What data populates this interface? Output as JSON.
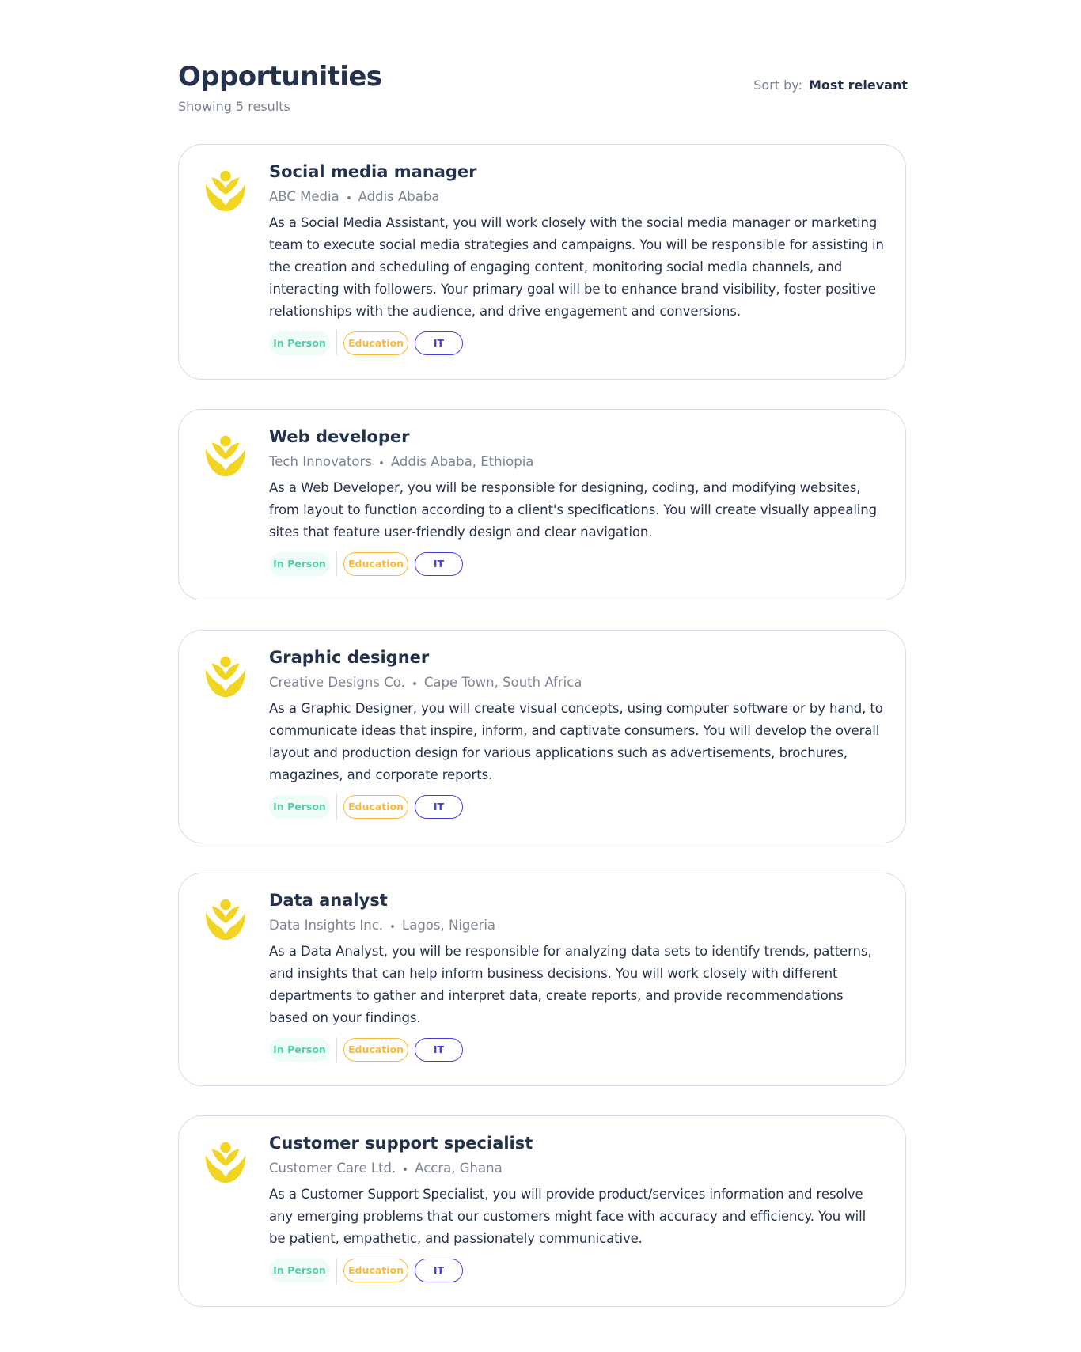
{
  "header": {
    "title": "Opportunities",
    "subtitle": "Showing 5 results",
    "sort_label": "Sort by:",
    "sort_value": "Most relevant"
  },
  "colors": {
    "text_dark": "#25324B",
    "text_muted": "#7C8493",
    "border": "#D6DDEB",
    "in_person_bg": "#EDFCF5",
    "in_person_text": "#56CDAD",
    "education": "#FFB836",
    "it": "#4640DE",
    "logo_yellow": "#F2D422"
  },
  "jobs": [
    {
      "title": "Social media manager",
      "company": "ABC Media",
      "location": "Addis Ababa",
      "description": "As a Social Media Assistant, you will work closely with the social media manager or marketing team to execute social media strategies and campaigns. You will be responsible for assisting in the creation and scheduling of engaging content, monitoring social media channels, and interacting with followers. Your primary goal will be to enhance brand visibility, foster positive relationships with the audience, and drive engagement and conversions.",
      "tags": [
        "In Person",
        "Education",
        "IT"
      ]
    },
    {
      "title": "Web developer",
      "company": "Tech Innovators",
      "location": "Addis Ababa, Ethiopia",
      "description": "As a Web Developer, you will be responsible for designing, coding, and modifying websites, from layout to function according to a client's specifications. You will create visually appealing sites that feature user-friendly design and clear navigation.",
      "tags": [
        "In Person",
        "Education",
        "IT"
      ]
    },
    {
      "title": "Graphic designer",
      "company": "Creative Designs Co.",
      "location": "Cape Town, South Africa",
      "description": "As a Graphic Designer, you will create visual concepts, using computer software or by hand, to communicate ideas that inspire, inform, and captivate consumers. You will develop the overall layout and production design for various applications such as advertisements, brochures, magazines, and corporate reports.",
      "tags": [
        "In Person",
        "Education",
        "IT"
      ]
    },
    {
      "title": "Data analyst",
      "company": "Data Insights Inc.",
      "location": "Lagos, Nigeria",
      "description": "As a Data Analyst, you will be responsible for analyzing data sets to identify trends, patterns, and insights that can help inform business decisions. You will work closely with different departments to gather and interpret data, create reports, and provide recommendations based on your findings.",
      "tags": [
        "In Person",
        "Education",
        "IT"
      ]
    },
    {
      "title": "Customer support specialist",
      "company": "Customer Care Ltd.",
      "location": "Accra, Ghana",
      "description": "As a Customer Support Specialist, you will provide product/services information and resolve any emerging problems that our customers might face with accuracy and efficiency. You will be patient, empathetic, and passionately communicative.",
      "tags": [
        "In Person",
        "Education",
        "IT"
      ]
    }
  ]
}
